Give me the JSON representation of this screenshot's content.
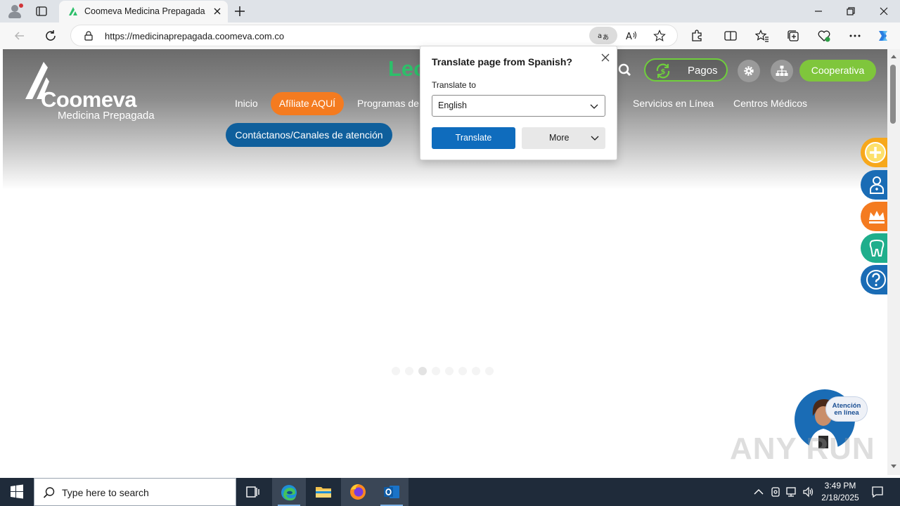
{
  "browser": {
    "tab": {
      "title": "Coomeva Medicina Prepagada"
    },
    "address": {
      "url": "https://medicinaprepagada.coomeva.com.co"
    }
  },
  "site": {
    "logo": {
      "name": "Coomeva",
      "subtitle": "Medicina Prepagada"
    },
    "banner_text_partial": "Leo",
    "menu": {
      "inicio": "Inicio",
      "afiliate": "Afíliate AQUÍ",
      "programas": "Programas de",
      "servicios": "Servicios en Línea",
      "centros": "Centros Médicos",
      "contact": "Contáctanos/Canales de atención"
    },
    "pagos_label": "Pagos",
    "cooperativa_label": "Cooperativa",
    "carousel": {
      "count": 8,
      "active_index": 2
    },
    "side_icons": [
      {
        "icon": "plus-coin-icon",
        "color": "#f7a81b"
      },
      {
        "icon": "doctor-icon",
        "color": "#1a6cb5"
      },
      {
        "icon": "crown-icon",
        "color": "#f47b20"
      },
      {
        "icon": "tooth-icon",
        "color": "#1fae8c"
      },
      {
        "icon": "help-icon",
        "color": "#1a6cb5"
      }
    ],
    "chat": {
      "line1": "Atención",
      "line2": "en línea"
    }
  },
  "translate_popup": {
    "title": "Translate page from Spanish?",
    "target_label": "Translate to",
    "target_language": "English",
    "translate_button": "Translate",
    "more_button": "More"
  },
  "watermark": "ANY RUN",
  "taskbar": {
    "search_placeholder": "Type here to search",
    "time": "3:49 PM",
    "date": "2/18/2025"
  },
  "colors": {
    "accent_orange": "#f47b20",
    "accent_green": "#7fc63c",
    "accent_blue": "#0f6cbd",
    "site_blue": "#0f5f9c"
  }
}
